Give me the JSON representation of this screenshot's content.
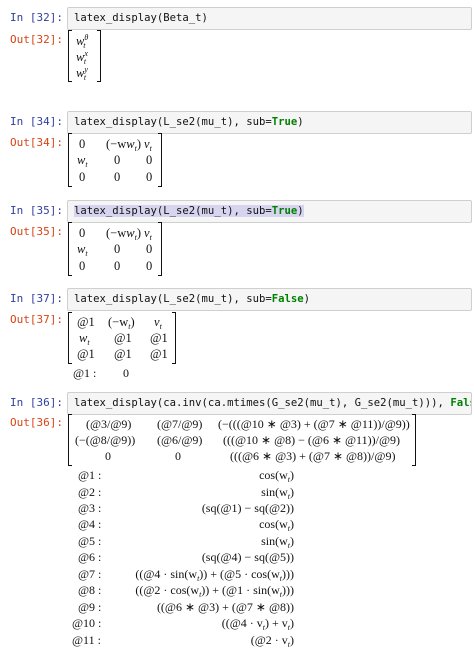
{
  "cells": [
    {
      "in_prompt": "In [32]:",
      "out_prompt": "Out[32]:",
      "code": "latex_display(Beta_t)"
    },
    {
      "in_prompt": "In [34]:",
      "out_prompt": "Out[34]:",
      "code_pre": "latex_display(L_se2(mu_t), sub=",
      "code_kw": "True",
      "code_post": ")"
    },
    {
      "in_prompt": "In [35]:",
      "out_prompt": "Out[35]:",
      "code_pre": "latex_display(L_se2(mu_t), sub=",
      "code_kw": "True",
      "code_post": ")"
    },
    {
      "in_prompt": "In [37]:",
      "out_prompt": "Out[37]:",
      "code_pre": "latex_display(L_se2(mu_t), sub=",
      "code_kw": "False",
      "code_post": ")"
    },
    {
      "in_prompt": "In [36]:",
      "out_prompt": "Out[36]:",
      "code_pre": "latex_display(ca.inv(ca.mtimes(G_se2(mu_t), G_se2(mu_t))), ",
      "code_kw": "False",
      "code_post": ")"
    }
  ],
  "beta": {
    "w": "w",
    "sub": "t",
    "sups": [
      "θ",
      "x",
      "y"
    ]
  },
  "l_matrix": [
    [
      "0",
      "(−w",
      "v"
    ],
    [
      "w",
      "0",
      "0"
    ],
    [
      "0",
      "0",
      "0"
    ]
  ],
  "l_matrix_subs": {
    "r0c1_close": ")",
    "t": "t"
  },
  "l_false_matrix": [
    [
      "@1",
      "(−w",
      "v"
    ],
    [
      "w",
      "@1",
      "@1"
    ],
    [
      "@1",
      "@1",
      "@1"
    ]
  ],
  "l_false_defs": [
    {
      "label": "@1 :",
      "value": "0"
    }
  ],
  "inv_matrix": [
    [
      "(@3/@9)",
      "(@7/@9)",
      "(−(((@10 ∗ @3) + (@7 ∗ @11))/@9))"
    ],
    [
      "(−(@8/@9))",
      "(@6/@9)",
      "(((@10 ∗ @8) − (@6 ∗ @11))/@9)"
    ],
    [
      "0",
      "0",
      "(((@6 ∗ @3) + (@7 ∗ @8))/@9)"
    ]
  ],
  "inv_defs": [
    {
      "label": "@1 :",
      "value": "cos(w"
    },
    {
      "label": "@2 :",
      "value": "sin(w"
    },
    {
      "label": "@3 :",
      "value": "(sq(@1) − sq(@2))"
    },
    {
      "label": "@4 :",
      "value": "cos(w"
    },
    {
      "label": "@5 :",
      "value": "sin(w"
    },
    {
      "label": "@6 :",
      "value": "(sq(@4) − sq(@5))"
    },
    {
      "label": "@7 :",
      "value": "((@4 · sin(w"
    },
    {
      "label": "@8 :",
      "value": "((@2 · cos(w"
    },
    {
      "label": "@9 :",
      "value": "((@6 ∗ @3) + (@7 ∗ @8))"
    },
    {
      "label": "@10 :",
      "value": "((@4 · v"
    },
    {
      "label": "@11 :",
      "value": "(@2 · v"
    }
  ],
  "inv_def_tails": {
    "d1": ")",
    "d2": ")",
    "d4": ")",
    "d5": ")",
    "d7_mid": ")) + (@5 · cos(w",
    "d7_end": ")))",
    "d8_mid": ")) + (@1 · sin(w",
    "d8_end": ")))",
    "d10_end": ") + v",
    "d10_close": ")",
    "d11_end": ")"
  }
}
